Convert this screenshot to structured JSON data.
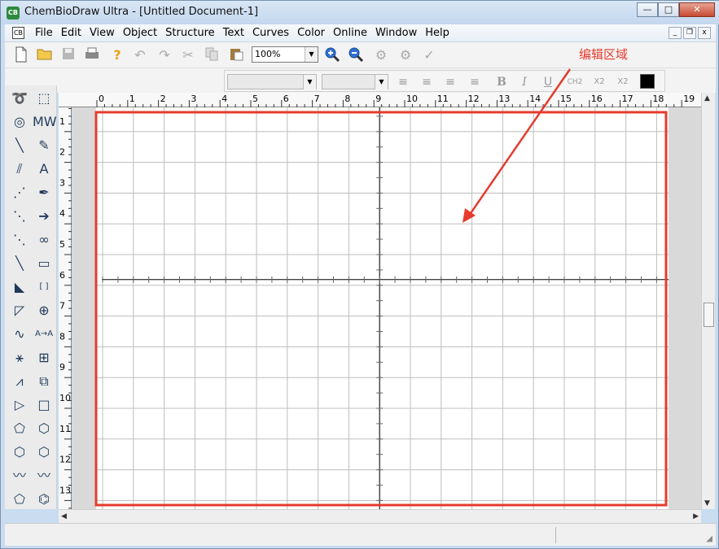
{
  "app": {
    "title": "ChemBioDraw Ultra - [Untitled Document-1]",
    "icon": "CB"
  },
  "window_controls": {
    "minimize": "—",
    "maximize": "□",
    "close": "✕"
  },
  "menu": {
    "doc_icon": "CB",
    "items": [
      "File",
      "Edit",
      "View",
      "Object",
      "Structure",
      "Text",
      "Curves",
      "Color",
      "Online",
      "Window",
      "Help"
    ]
  },
  "mdi_controls": {
    "min": "_",
    "restore": "❐",
    "close": "x"
  },
  "toolbar": {
    "zoom": "100%"
  },
  "annotation": {
    "label": "编辑区域"
  },
  "format_bar": {
    "bold": "B",
    "italic": "I",
    "underline": "U",
    "ch2": "CH2",
    "subscript": "X2",
    "superscript": "X2"
  },
  "ruler": {
    "h": [
      "0",
      "1",
      "2",
      "3",
      "4",
      "5",
      "6",
      "7",
      "8",
      "9",
      "10",
      "11",
      "12",
      "13",
      "14",
      "15",
      "16",
      "17",
      "18",
      "19"
    ],
    "v": [
      "1",
      "2",
      "3",
      "4",
      "5",
      "6",
      "7",
      "8",
      "9",
      "10",
      "11",
      "12",
      "13"
    ]
  },
  "colors": {
    "accent": "#e53b2e",
    "chrome": "#c9dcf0",
    "grid": "#bdbdbd",
    "icon_dark": "#1f3a5a"
  },
  "icons": {
    "toolbar": [
      "new-icon",
      "open-icon",
      "save-icon",
      "print-icon",
      "help-icon",
      "undo-icon",
      "redo-icon",
      "cut-icon",
      "copy-icon",
      "paste-icon",
      "zoom-in-icon",
      "zoom-out-icon",
      "structure-check-icon",
      "structure-clean-icon",
      "checkmark-icon"
    ],
    "palette": [
      "lasso-icon",
      "marquee-icon",
      "rotate-icon",
      "mass-fragment-icon",
      "solid-bond-icon",
      "eraser-icon",
      "multiple-bond-icon",
      "text-icon",
      "dashed-bond-icon",
      "pen-icon",
      "hashed-bond-icon",
      "arrow-icon",
      "hashed-wedge-icon",
      "orbital-icon",
      "bold-bond-icon",
      "drawing-element-icon",
      "wedge-bond-icon",
      "bracket-icon",
      "hollow-wedge-icon",
      "chemical-symbol-icon",
      "wavy-bond-icon",
      "query-icon",
      "chain-icon",
      "table-icon",
      "tlc-icon",
      "templates-icon",
      "cyclopropane-icon",
      "cyclobutane-icon",
      "cyclopentane-icon",
      "cyclohexane-icon",
      "cyclohexane-chair-icon",
      "cycloheptane-icon",
      "cyclohexane-chair-2-icon",
      "cyclooctane-icon",
      "cyclopentadiene-icon",
      "benzene-icon"
    ]
  }
}
